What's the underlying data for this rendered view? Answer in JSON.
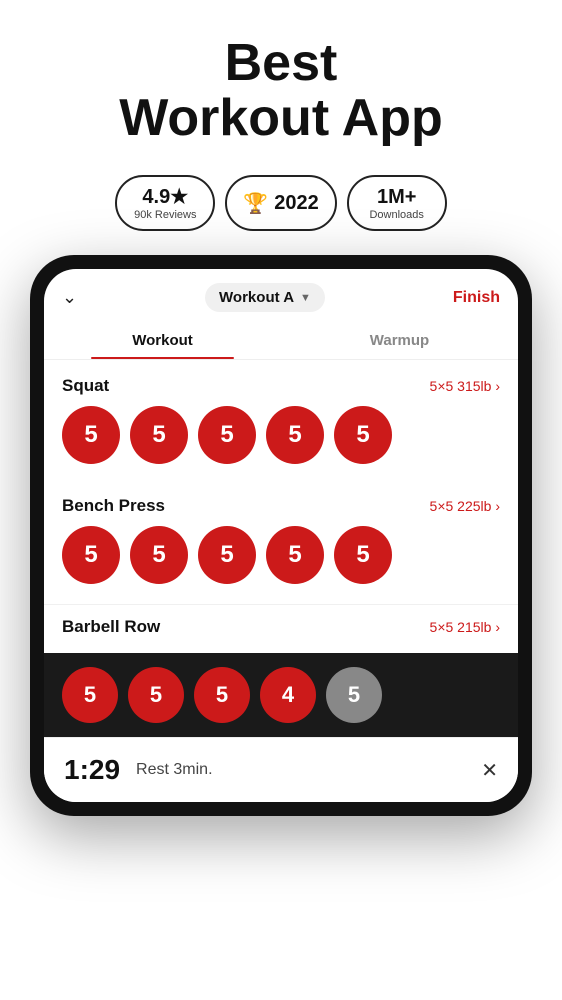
{
  "header": {
    "title": "Best",
    "title2": "Workout App"
  },
  "badges": [
    {
      "main": "4.9★",
      "sub": "90k Reviews",
      "trophy": false
    },
    {
      "main": "2022",
      "sub": "",
      "trophy": true
    },
    {
      "main": "1M+",
      "sub": "Downloads",
      "trophy": false
    }
  ],
  "app": {
    "chevron": "ˇ",
    "workout_selector": "Workout A",
    "finish_label": "Finish",
    "tabs": [
      {
        "label": "Workout",
        "active": true
      },
      {
        "label": "Warmup",
        "active": false
      }
    ],
    "exercises": [
      {
        "name": "Squat",
        "info": "5×5 315lb ›",
        "sets": [
          {
            "reps": "5",
            "done": true
          },
          {
            "reps": "5",
            "done": true
          },
          {
            "reps": "5",
            "done": true
          },
          {
            "reps": "5",
            "done": true
          },
          {
            "reps": "5",
            "done": true
          }
        ]
      },
      {
        "name": "Bench Press",
        "info": "5×5 225lb ›",
        "sets": [
          {
            "reps": "5",
            "done": true
          },
          {
            "reps": "5",
            "done": true
          },
          {
            "reps": "5",
            "done": true
          },
          {
            "reps": "5",
            "done": true
          },
          {
            "reps": "5",
            "done": true
          }
        ]
      },
      {
        "name": "Barbell Row",
        "info": "5×5 215lb ›",
        "sets": [
          {
            "reps": "5",
            "done": true
          },
          {
            "reps": "5",
            "done": true
          },
          {
            "reps": "5",
            "done": true
          },
          {
            "reps": "4",
            "done": true
          },
          {
            "reps": "5",
            "done": false
          }
        ]
      }
    ],
    "rest": {
      "timer": "1:29",
      "label": "Rest 3min."
    }
  },
  "colors": {
    "red": "#cc1a1a",
    "dark": "#1a1a1a",
    "inactive_circle": "#888888"
  }
}
